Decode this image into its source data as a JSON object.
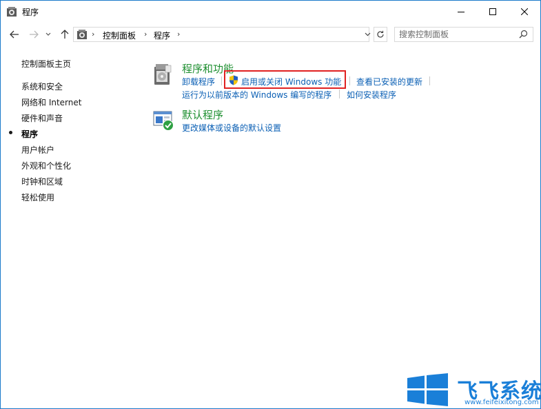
{
  "window": {
    "title": "程序",
    "icon": "control-panel-icon",
    "controls": [
      "minimize-icon",
      "maximize-icon",
      "close-icon"
    ]
  },
  "address_bar": {
    "breadcrumbs": [
      "控制面板",
      "程序"
    ],
    "search_placeholder": "搜索控制面板"
  },
  "sidebar": {
    "home": "控制面板主页",
    "items": [
      {
        "label": "系统和安全"
      },
      {
        "label": "网络和 Internet"
      },
      {
        "label": "硬件和声音"
      },
      {
        "label": "程序",
        "current": true
      },
      {
        "label": "用户帐户"
      },
      {
        "label": "外观和个性化"
      },
      {
        "label": "时钟和区域"
      },
      {
        "label": "轻松使用"
      }
    ]
  },
  "main": {
    "categories": [
      {
        "title": "程序和功能",
        "icon": "programs-features-icon",
        "tasks": [
          "卸载程序",
          "启用或关闭 Windows 功能",
          "查看已安装的更新",
          "运行为以前版本的 Windows 编写的程序",
          "如何安装程序"
        ]
      },
      {
        "title": "默认程序",
        "icon": "default-programs-icon",
        "tasks": [
          "更改媒体或设备的默认设置"
        ]
      }
    ],
    "highlight_color": "#e02020"
  },
  "watermark": {
    "brand": "飞飞系统",
    "url": "www.feifeixitong.com"
  },
  "colors": {
    "accent_border": "#1979ca",
    "link": "#0a5fb4",
    "category_title": "#1e8f30"
  }
}
